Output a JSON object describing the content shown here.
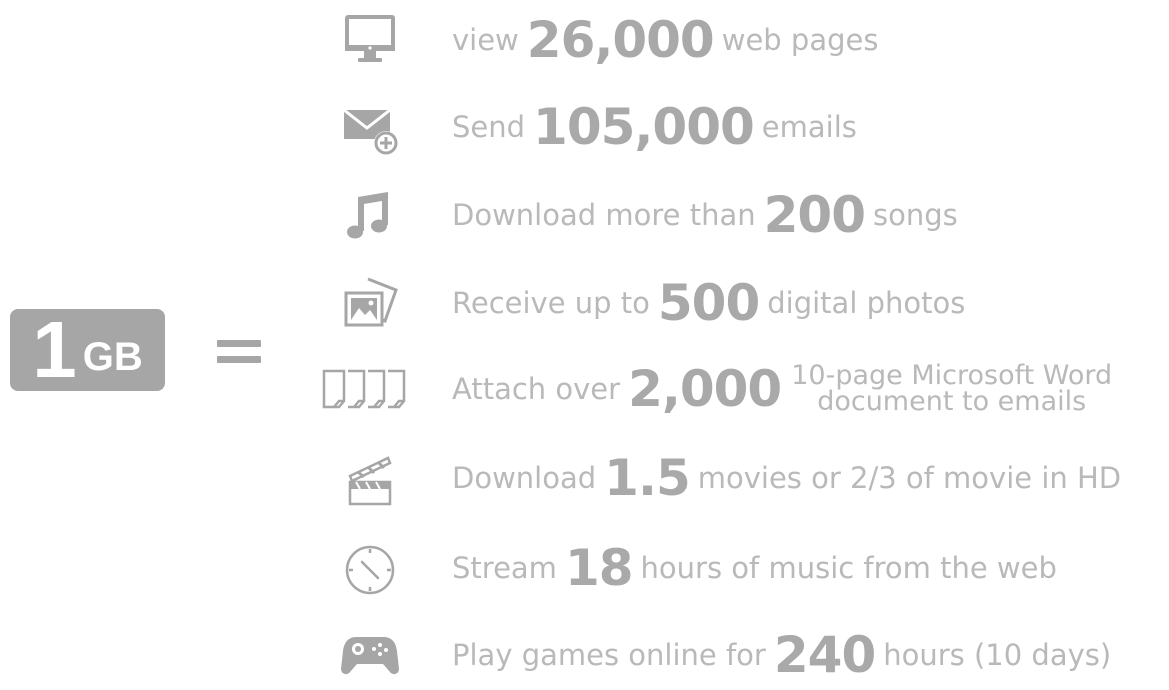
{
  "badge": {
    "number": "1",
    "unit": "GB"
  },
  "equals": "=",
  "items": [
    {
      "icon": "monitor-icon",
      "pre": "view",
      "value": "26,000",
      "post": "web pages"
    },
    {
      "icon": "email-add-icon",
      "pre": "Send",
      "value": "105,000",
      "post": "emails"
    },
    {
      "icon": "music-note-icon",
      "pre": "Download more than",
      "value": "200",
      "post": "songs"
    },
    {
      "icon": "photos-icon",
      "pre": "Receive up to",
      "value": "500",
      "post": "digital photos"
    },
    {
      "icon": "documents-icon",
      "pre": "Attach over",
      "value": "2,000",
      "post_line1": "10-page Microsoft Word",
      "post_line2": "document to emails"
    },
    {
      "icon": "clapperboard-icon",
      "pre": "Download",
      "value": "1.5",
      "post": "movies or 2/3 of movie in HD"
    },
    {
      "icon": "clock-icon",
      "pre": "Stream",
      "value": "18",
      "post": "hours of music from the web"
    },
    {
      "icon": "game-controller-icon",
      "pre": "Play games online for",
      "value": "240",
      "post": "hours (10 days)"
    }
  ],
  "colors": {
    "icon_gray": "#a6a6a6",
    "text_gray": "#b9b9b9",
    "number_gray": "#a9a9a9"
  }
}
